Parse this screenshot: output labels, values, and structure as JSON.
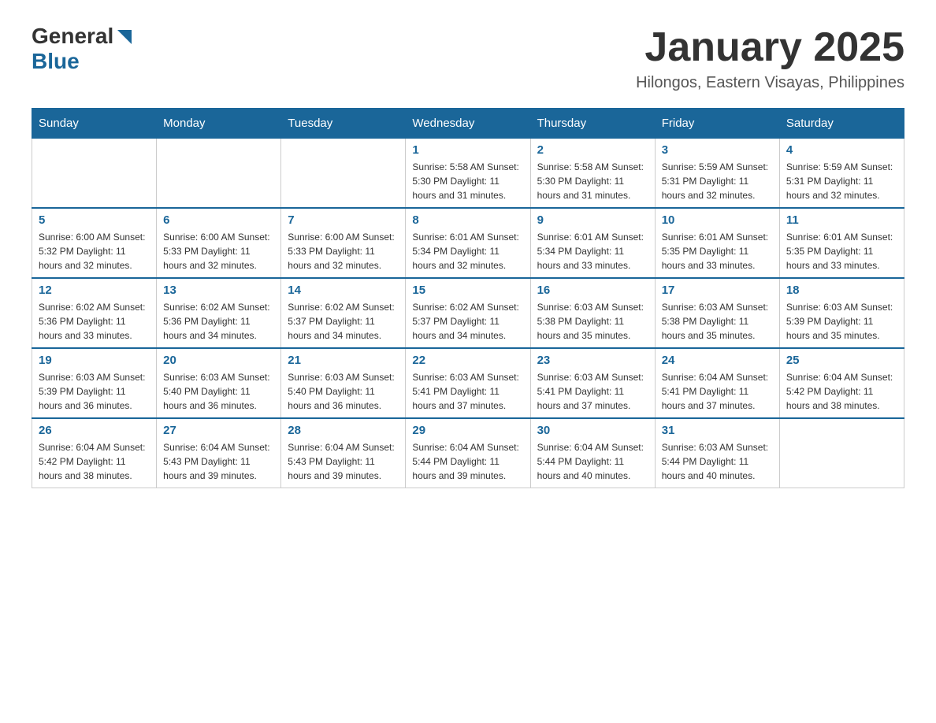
{
  "header": {
    "logo": {
      "general": "General",
      "blue": "Blue"
    },
    "title": "January 2025",
    "subtitle": "Hilongos, Eastern Visayas, Philippines"
  },
  "days_of_week": [
    "Sunday",
    "Monday",
    "Tuesday",
    "Wednesday",
    "Thursday",
    "Friday",
    "Saturday"
  ],
  "weeks": [
    [
      {
        "day": "",
        "info": ""
      },
      {
        "day": "",
        "info": ""
      },
      {
        "day": "",
        "info": ""
      },
      {
        "day": "1",
        "info": "Sunrise: 5:58 AM\nSunset: 5:30 PM\nDaylight: 11 hours and 31 minutes."
      },
      {
        "day": "2",
        "info": "Sunrise: 5:58 AM\nSunset: 5:30 PM\nDaylight: 11 hours and 31 minutes."
      },
      {
        "day": "3",
        "info": "Sunrise: 5:59 AM\nSunset: 5:31 PM\nDaylight: 11 hours and 32 minutes."
      },
      {
        "day": "4",
        "info": "Sunrise: 5:59 AM\nSunset: 5:31 PM\nDaylight: 11 hours and 32 minutes."
      }
    ],
    [
      {
        "day": "5",
        "info": "Sunrise: 6:00 AM\nSunset: 5:32 PM\nDaylight: 11 hours and 32 minutes."
      },
      {
        "day": "6",
        "info": "Sunrise: 6:00 AM\nSunset: 5:33 PM\nDaylight: 11 hours and 32 minutes."
      },
      {
        "day": "7",
        "info": "Sunrise: 6:00 AM\nSunset: 5:33 PM\nDaylight: 11 hours and 32 minutes."
      },
      {
        "day": "8",
        "info": "Sunrise: 6:01 AM\nSunset: 5:34 PM\nDaylight: 11 hours and 32 minutes."
      },
      {
        "day": "9",
        "info": "Sunrise: 6:01 AM\nSunset: 5:34 PM\nDaylight: 11 hours and 33 minutes."
      },
      {
        "day": "10",
        "info": "Sunrise: 6:01 AM\nSunset: 5:35 PM\nDaylight: 11 hours and 33 minutes."
      },
      {
        "day": "11",
        "info": "Sunrise: 6:01 AM\nSunset: 5:35 PM\nDaylight: 11 hours and 33 minutes."
      }
    ],
    [
      {
        "day": "12",
        "info": "Sunrise: 6:02 AM\nSunset: 5:36 PM\nDaylight: 11 hours and 33 minutes."
      },
      {
        "day": "13",
        "info": "Sunrise: 6:02 AM\nSunset: 5:36 PM\nDaylight: 11 hours and 34 minutes."
      },
      {
        "day": "14",
        "info": "Sunrise: 6:02 AM\nSunset: 5:37 PM\nDaylight: 11 hours and 34 minutes."
      },
      {
        "day": "15",
        "info": "Sunrise: 6:02 AM\nSunset: 5:37 PM\nDaylight: 11 hours and 34 minutes."
      },
      {
        "day": "16",
        "info": "Sunrise: 6:03 AM\nSunset: 5:38 PM\nDaylight: 11 hours and 35 minutes."
      },
      {
        "day": "17",
        "info": "Sunrise: 6:03 AM\nSunset: 5:38 PM\nDaylight: 11 hours and 35 minutes."
      },
      {
        "day": "18",
        "info": "Sunrise: 6:03 AM\nSunset: 5:39 PM\nDaylight: 11 hours and 35 minutes."
      }
    ],
    [
      {
        "day": "19",
        "info": "Sunrise: 6:03 AM\nSunset: 5:39 PM\nDaylight: 11 hours and 36 minutes."
      },
      {
        "day": "20",
        "info": "Sunrise: 6:03 AM\nSunset: 5:40 PM\nDaylight: 11 hours and 36 minutes."
      },
      {
        "day": "21",
        "info": "Sunrise: 6:03 AM\nSunset: 5:40 PM\nDaylight: 11 hours and 36 minutes."
      },
      {
        "day": "22",
        "info": "Sunrise: 6:03 AM\nSunset: 5:41 PM\nDaylight: 11 hours and 37 minutes."
      },
      {
        "day": "23",
        "info": "Sunrise: 6:03 AM\nSunset: 5:41 PM\nDaylight: 11 hours and 37 minutes."
      },
      {
        "day": "24",
        "info": "Sunrise: 6:04 AM\nSunset: 5:41 PM\nDaylight: 11 hours and 37 minutes."
      },
      {
        "day": "25",
        "info": "Sunrise: 6:04 AM\nSunset: 5:42 PM\nDaylight: 11 hours and 38 minutes."
      }
    ],
    [
      {
        "day": "26",
        "info": "Sunrise: 6:04 AM\nSunset: 5:42 PM\nDaylight: 11 hours and 38 minutes."
      },
      {
        "day": "27",
        "info": "Sunrise: 6:04 AM\nSunset: 5:43 PM\nDaylight: 11 hours and 39 minutes."
      },
      {
        "day": "28",
        "info": "Sunrise: 6:04 AM\nSunset: 5:43 PM\nDaylight: 11 hours and 39 minutes."
      },
      {
        "day": "29",
        "info": "Sunrise: 6:04 AM\nSunset: 5:44 PM\nDaylight: 11 hours and 39 minutes."
      },
      {
        "day": "30",
        "info": "Sunrise: 6:04 AM\nSunset: 5:44 PM\nDaylight: 11 hours and 40 minutes."
      },
      {
        "day": "31",
        "info": "Sunrise: 6:03 AM\nSunset: 5:44 PM\nDaylight: 11 hours and 40 minutes."
      },
      {
        "day": "",
        "info": ""
      }
    ]
  ]
}
